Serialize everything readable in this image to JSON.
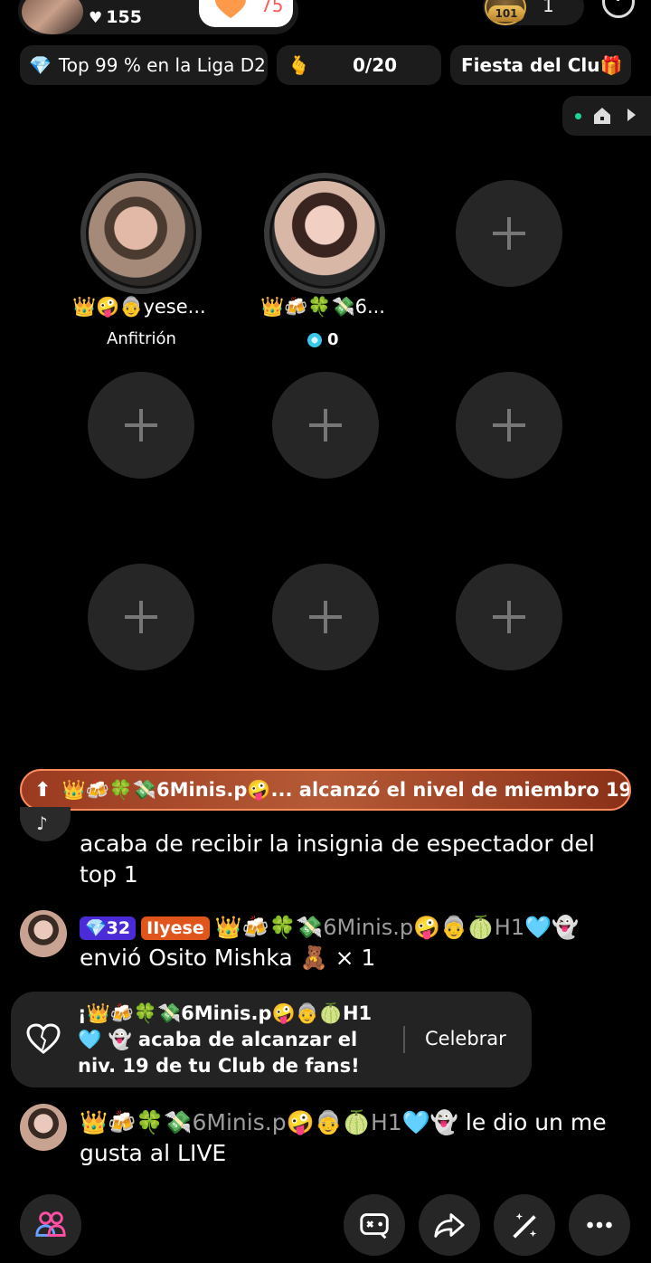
{
  "header": {
    "likes_count": "155",
    "follow_count": "75",
    "viewer_level": "101",
    "viewer_count": "1"
  },
  "info_pills": {
    "league": "Top 99 % en la Liga D2",
    "goal_progress": "0/20",
    "fiesta": "Fiesta del Clu"
  },
  "seats": {
    "host": {
      "name": "👑🤪👵yese...",
      "role": "Anfitrión"
    },
    "guest": {
      "name": "👑🍻🍀💸6...",
      "coins": "0"
    }
  },
  "banner": {
    "text": "👑🍻🍀💸6Minis.p🤪... alcanzó el nivel de miembro 19 🧡"
  },
  "chat": {
    "message1": "acaba de recibir la insignia de espectador del top 1",
    "message2": {
      "level_badge": "32",
      "fan_badge": "yese",
      "nickname": "👑🍻🍀💸6Minis.p🤪👵🍈H1🩵👻",
      "text": "envió Osito Mishka 🧸 × 1"
    },
    "celebrate": {
      "text": "¡👑🍻🍀💸6Minis.p🤪👵🍈H1🩵 👻 acaba de alcanzar el niv. 19 de tu Club de fans!",
      "button": "Celebrar"
    },
    "message3": {
      "nickname": "👑🍻🍀💸6Minis.p🤪👵🍈H1🩵👻",
      "text": "le dio un me gusta al LIVE"
    }
  },
  "colors": {
    "background": "#000000",
    "seat_empty": "#262626",
    "banner_border": "#ff8a5a",
    "level_badge": "#4b2bd8",
    "fan_badge": "#e0551c"
  }
}
